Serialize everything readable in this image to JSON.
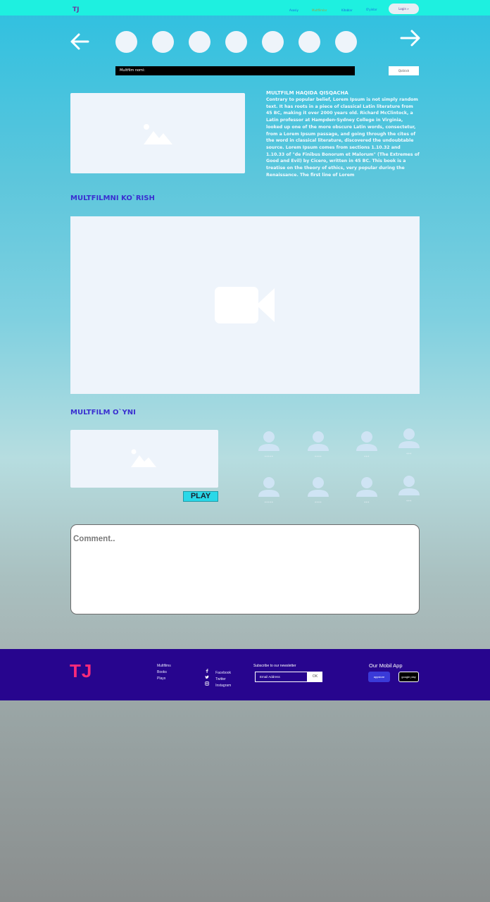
{
  "header": {
    "logo": "TJ",
    "nav": [
      "Asosiy",
      "Multfilmlar",
      "Kitoblar",
      "O'yinlar"
    ],
    "login_label": "Login »",
    "colors": {
      "bar": "#1ef0e0",
      "logo": "#6a3aa0"
    }
  },
  "carousel": {
    "prev_icon": "arrow-left-icon",
    "next_icon": "arrow-right-icon",
    "item_count": 7
  },
  "search": {
    "placeholder": "Multfilm nomi:",
    "button_label": "Qidirish"
  },
  "info": {
    "title": "MULTFILM HAQIDA QISQACHA",
    "text": "Contrary to popular belief, Lorem Ipsum is not simply random text. It has roots in a piece of classical Latin literature from 45 BC, making it over 2000 years old. Richard McClintock, a Latin professor at Hampden-Sydney College in Virginia, looked up one of the more obscure Latin words, consectetur, from a Lorem Ipsum passage, and going through the cites of the word in classical literature, discovered the undoubtable source. Lorem Ipsum comes from sections 1.10.32 and 1.10.33 of \"de Finibus Bonorum et Malorum\" (The Extremes of Good and Evil) by Cicero, written in 45 BC. This book is a treatise on the theory of ethics, very popular during the Renaissance. The first line of Lorem",
    "image_icon": "image-placeholder-icon"
  },
  "watch": {
    "heading": "MULTFILMNI KO`RISH",
    "video_icon": "video-camera-icon"
  },
  "game": {
    "heading": "MULTFILM O`YNI",
    "play_label": "PLAY",
    "players": [
      "*****",
      "****",
      "***",
      "***",
      "*****",
      "****",
      "***",
      "***"
    ]
  },
  "comment": {
    "placeholder": "Comment.."
  },
  "footer": {
    "logo": "TJ",
    "links": [
      "Multfilms",
      "Books",
      "Plays"
    ],
    "social": [
      {
        "icon": "facebook-icon",
        "label": "Facebook"
      },
      {
        "icon": "twitter-icon",
        "label": "Twitter"
      },
      {
        "icon": "instagram-icon",
        "label": "Instagram"
      }
    ],
    "newsletter_title": "Subscribe to our newsletter",
    "email_placeholder": "Email Address",
    "email_button": "OK",
    "app_title": "Our Mobil App",
    "app_store": "appstore",
    "google_play": "google play",
    "colors": {
      "background": "#27058e",
      "logo": "#ff2a7a"
    }
  }
}
